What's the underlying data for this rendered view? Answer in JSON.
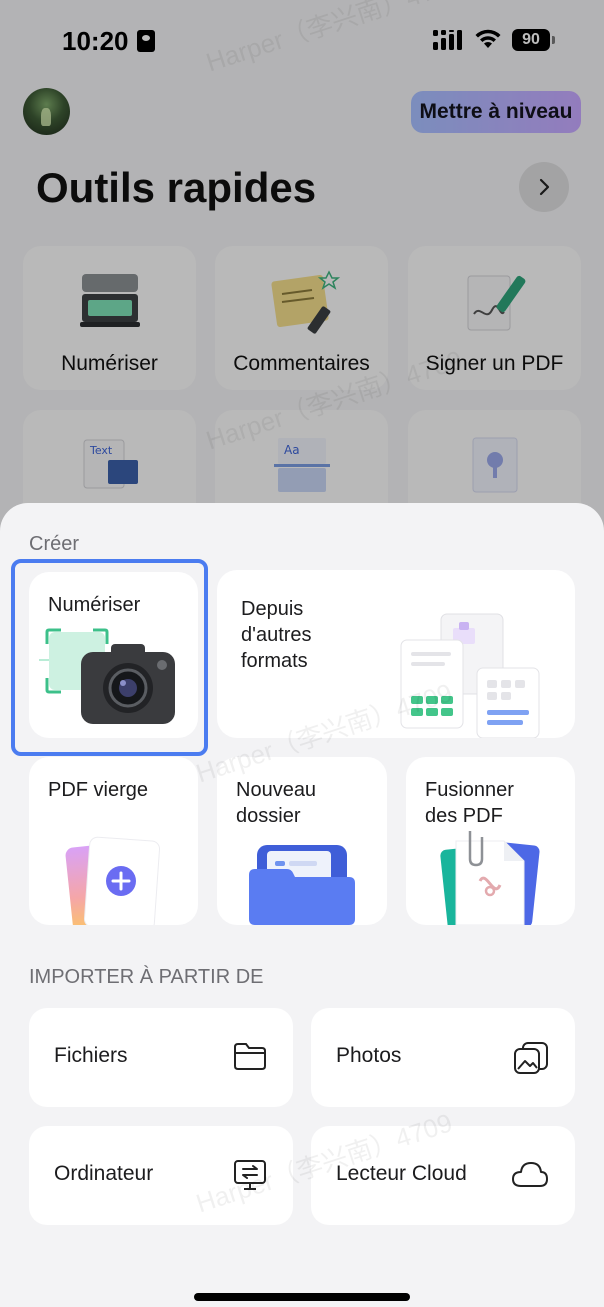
{
  "status_bar": {
    "time": "10:20",
    "battery": "90"
  },
  "header": {
    "upgrade_label": "Mettre à niveau",
    "title": "Outils rapides"
  },
  "quick_tools": [
    {
      "label": "Numériser",
      "icon": "scanner-icon"
    },
    {
      "label": "Commentaires",
      "icon": "notes-icon"
    },
    {
      "label": "Signer un PDF",
      "icon": "signature-icon"
    },
    {
      "label": "",
      "icon": "text-image-icon"
    },
    {
      "label": "",
      "icon": "ocr-icon"
    },
    {
      "label": "",
      "icon": "image-doc-icon"
    }
  ],
  "create": {
    "section_label": "Créer",
    "items": [
      {
        "label": "Numériser",
        "icon": "camera-icon",
        "selected": true
      },
      {
        "label": "Depuis\nd'autres\nformats",
        "icon": "documents-icon"
      },
      {
        "label": "PDF vierge",
        "icon": "blank-pdf-icon"
      },
      {
        "label": "Nouveau\ndossier",
        "icon": "folder-icon"
      },
      {
        "label": "Fusionner\ndes PDF",
        "icon": "merge-pdf-icon"
      }
    ]
  },
  "import": {
    "section_label": "IMPORTER À PARTIR DE",
    "items": [
      {
        "label": "Fichiers",
        "icon": "folder-outline-icon"
      },
      {
        "label": "Photos",
        "icon": "photos-icon"
      },
      {
        "label": "Ordinateur",
        "icon": "computer-transfer-icon"
      },
      {
        "label": "Lecteur Cloud",
        "icon": "cloud-icon"
      }
    ]
  },
  "watermark_text": "Harper（李兴南）4709",
  "colors": {
    "selection": "#4b7cf0",
    "upgrade_from": "#a7bfff",
    "upgrade_to": "#c7a8ff"
  }
}
